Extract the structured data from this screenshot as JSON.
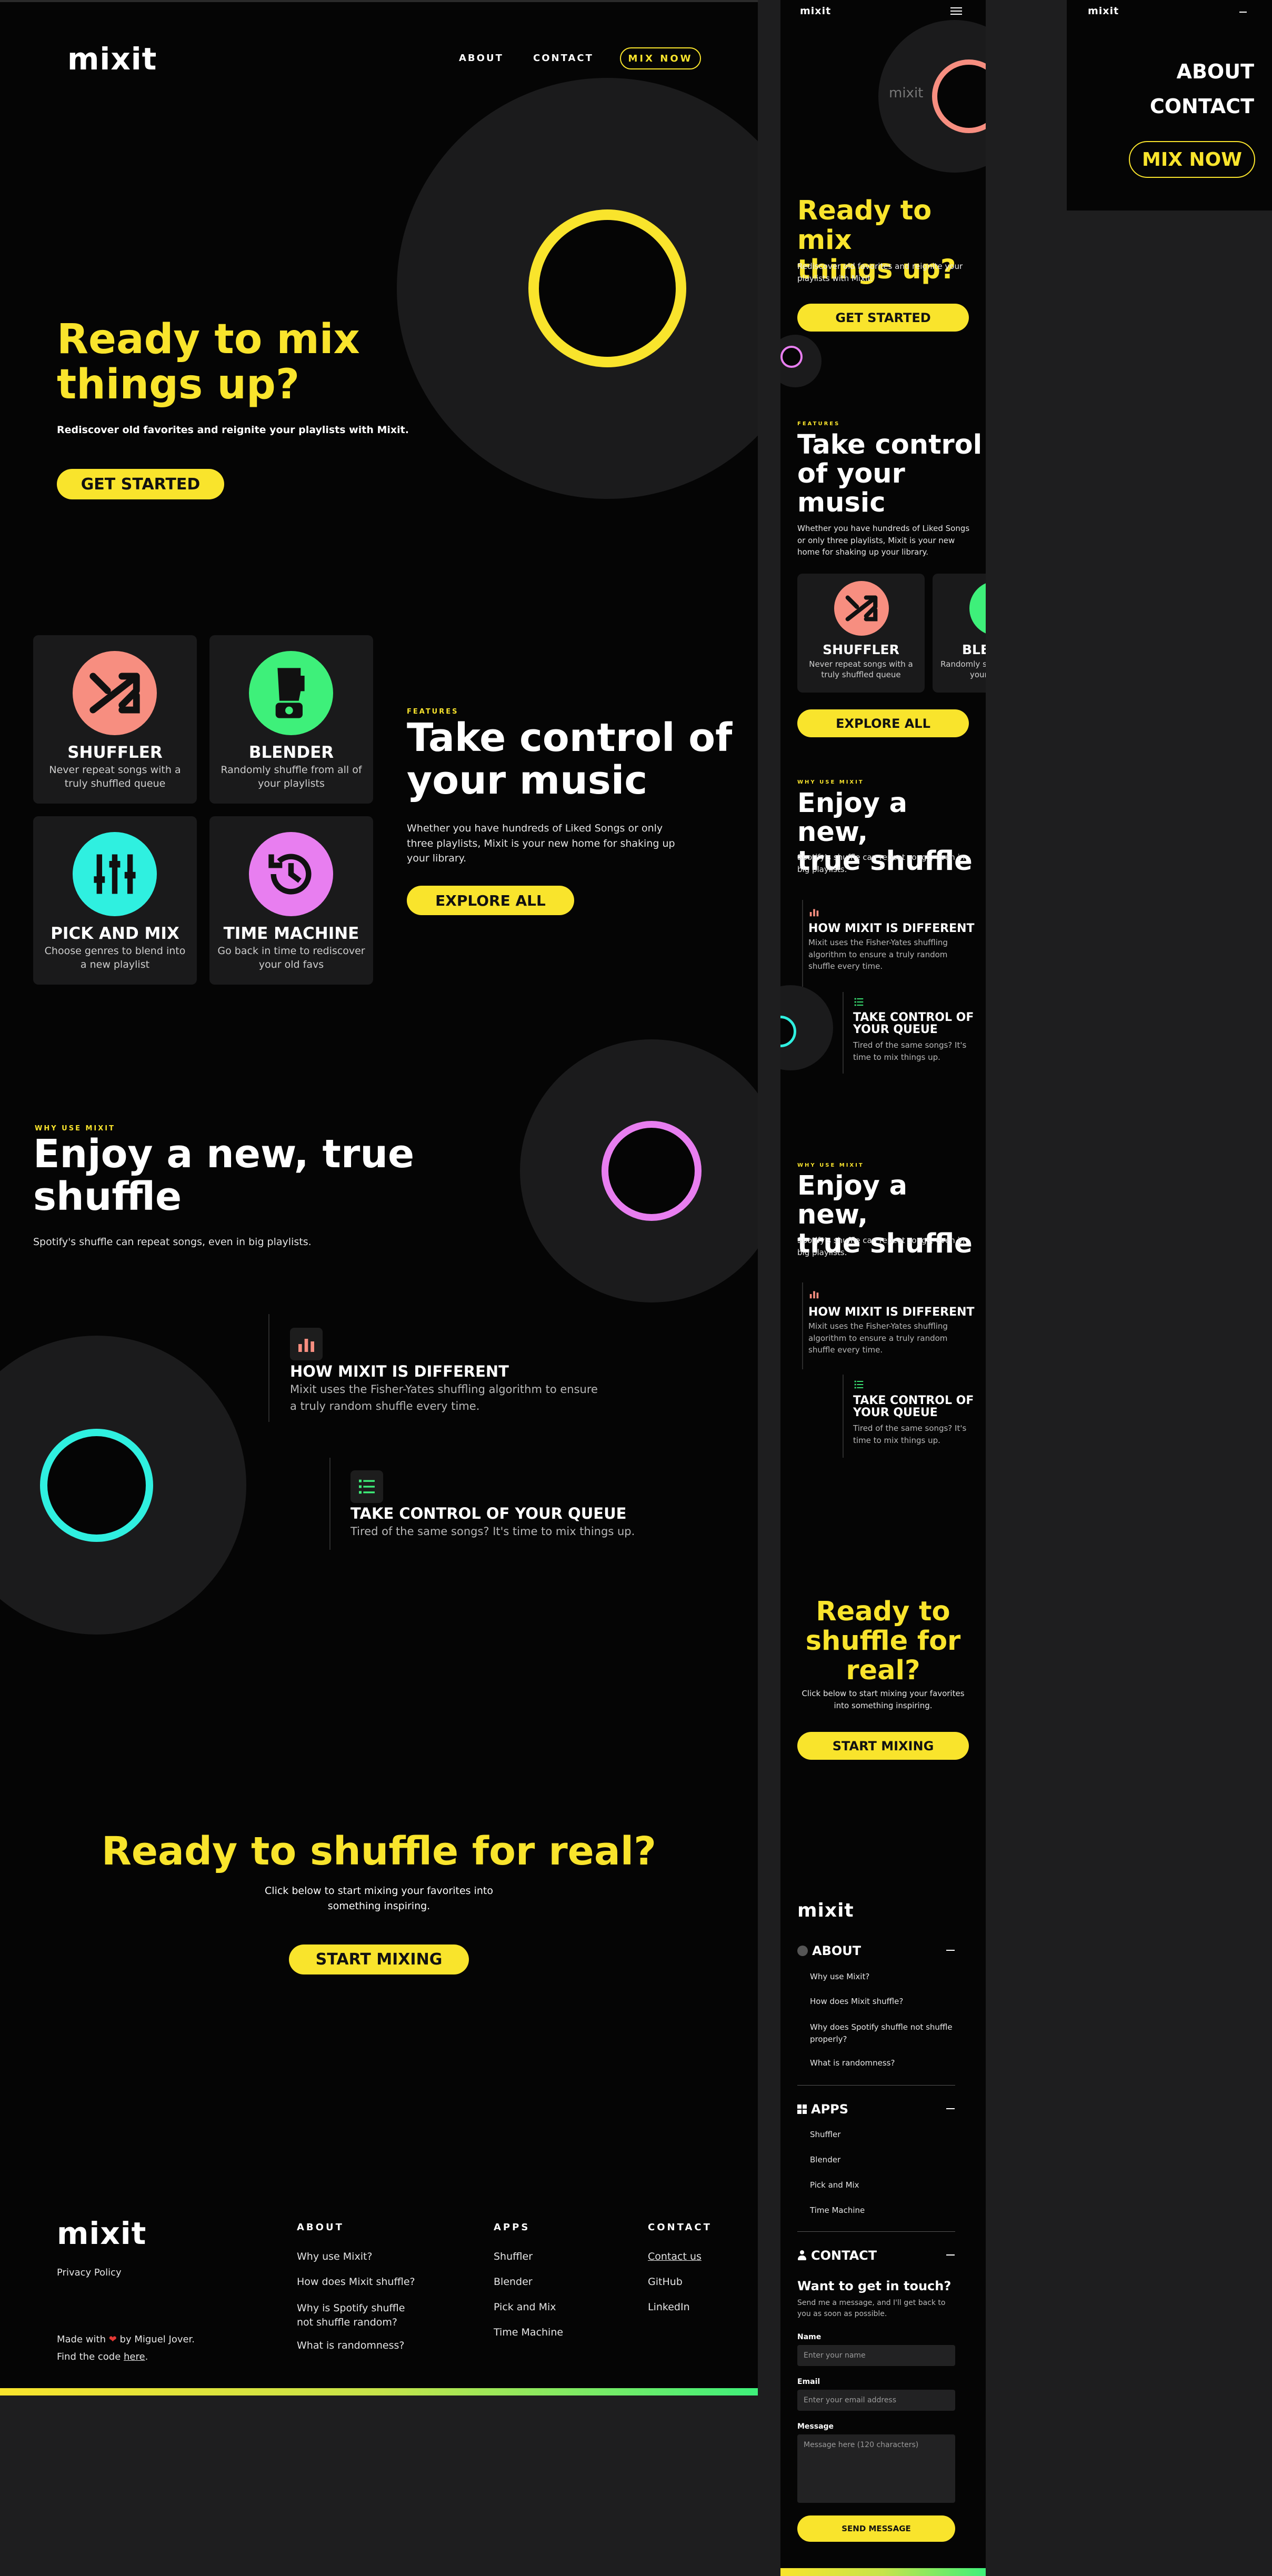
{
  "colors": {
    "accent": "#f9e42c",
    "salmon": "#f78e80",
    "green": "#3ef07a",
    "cyan": "#2ff0e0",
    "pink": "#e87ef0",
    "bg": "#050505",
    "card": "#1a1a1b"
  },
  "brand": {
    "logo": "mixit"
  },
  "nav": {
    "about": "ABOUT",
    "contact": "CONTACT",
    "mix_now": "MIX NOW"
  },
  "hero": {
    "title_line1": "Ready to mix",
    "title_line2": "things up?",
    "subtitle": "Rediscover old favorites and reignite your playlists with Mixit.",
    "cta": "GET STARTED"
  },
  "features": {
    "eyebrow": "FEATURES",
    "title_line1": "Take control of",
    "title_line2": "your music",
    "text": "Whether you have hundreds of Liked Songs or only three playlists, Mixit is your new home for shaking up your library.",
    "cta": "EXPLORE ALL",
    "cards": [
      {
        "title": "SHUFFLER",
        "desc": "Never repeat songs with a truly shuffled queue",
        "icon": "shuffle-icon",
        "color": "#f78e80"
      },
      {
        "title": "BLENDER",
        "desc": "Randomly shuffle from all of your playlists",
        "icon": "blender-icon",
        "color": "#3ef07a"
      },
      {
        "title": "PICK AND MIX",
        "desc": "Choose genres to blend into a new playlist",
        "icon": "sliders-icon",
        "color": "#2ff0e0"
      },
      {
        "title": "TIME MACHINE",
        "desc": "Go back in time to rediscover your old favs",
        "icon": "history-icon",
        "color": "#e87ef0"
      }
    ]
  },
  "why": {
    "eyebrow": "WHY USE MIXIT",
    "title_line1": "Enjoy a new, true",
    "title_line2": "shuffle",
    "text": "Spotify's shuffle can repeat songs, even in big playlists.",
    "items": [
      {
        "title": "HOW MIXIT IS DIFFERENT",
        "text": "Mixit uses the Fisher-Yates shuffling algorithm to ensure a truly random shuffle every time.",
        "icon": "bar-chart-icon"
      },
      {
        "title": "TAKE CONTROL OF YOUR QUEUE",
        "text": "Tired of the same songs?  It's time to mix things up.",
        "icon": "list-icon"
      }
    ]
  },
  "cta_section": {
    "title": "Ready to shuffle for real?",
    "text_line1": "Click below to start mixing your favorites into",
    "text_line2": "something inspiring.",
    "cta": "START MIXING"
  },
  "footer": {
    "privacy": "Privacy Policy",
    "made_with": "Made with",
    "by": "by Miguel Jover.",
    "find_code": "Find the code",
    "here": "here",
    "about_heading": "ABOUT",
    "about_links": [
      "Why use Mixit?",
      "How does Mixit shuffle?",
      "Why is Spotify shuffle not shuffle random?",
      "What is randomness?"
    ],
    "apps_heading": "APPS",
    "apps_links": [
      "Shuffler",
      "Blender",
      "Pick and Mix",
      "Time Machine"
    ],
    "contact_heading": "CONTACT",
    "contact_links": [
      "Contact us",
      "GitHub",
      "LinkedIn"
    ]
  },
  "mobile": {
    "hero_title_line1": "Ready to mix",
    "hero_title_line2": "things up?",
    "hero_subtitle": "Rediscover old favorites and reignite your playlists with Mixit.",
    "features_title_line1": "Take control",
    "features_title_line2": "of your",
    "features_title_line3": "music",
    "features_text": "Whether you have hundreds of Liked Songs or only three playlists, Mixit is your new home for shaking up your library.",
    "why_title_line1": "Enjoy a new,",
    "why_title_line2": "true shuffle",
    "why_text": "Spotify's shuffle can repeat songs, even in big playlists.",
    "queue_title_line1": "TAKE CONTROL OF",
    "queue_title_line2": "YOUR QUEUE",
    "queue_text": "Tired of the same songs? It's time to mix things up.",
    "cta_title_line1": "Ready to",
    "cta_title_line2": "shuffle for",
    "cta_title_line3": "real?",
    "cta_text": "Click below to start mixing your favorites into something inspiring.",
    "footer_about": "ABOUT",
    "footer_about_links": [
      "Why use Mixit?",
      "How does Mixit shuffle?",
      "Why does Spotify shuffle not shuffle properly?",
      "What is randomness?"
    ],
    "footer_apps": "APPS",
    "footer_apps_links": [
      "Shuffler",
      "Blender",
      "Pick and Mix",
      "Time Machine"
    ],
    "footer_contact": "CONTACT",
    "contact_title": "Want to get in touch?",
    "contact_text": "Send me a message, and I'll get back to you as soon as possible.",
    "name_label": "Name",
    "name_placeholder": "Enter your name",
    "email_label": "Email",
    "email_placeholder": "Enter your email address",
    "message_label": "Message",
    "message_placeholder": "Message here (120 characters)",
    "send": "SEND MESSAGE"
  }
}
